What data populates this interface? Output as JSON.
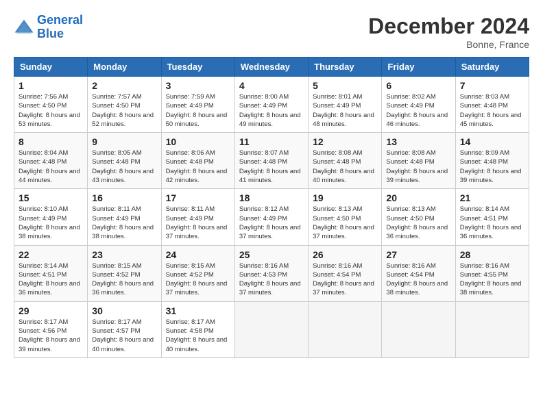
{
  "header": {
    "logo_line1": "General",
    "logo_line2": "Blue",
    "month": "December 2024",
    "location": "Bonne, France"
  },
  "weekdays": [
    "Sunday",
    "Monday",
    "Tuesday",
    "Wednesday",
    "Thursday",
    "Friday",
    "Saturday"
  ],
  "weeks": [
    [
      {
        "day": "1",
        "sunrise": "7:56 AM",
        "sunset": "4:50 PM",
        "daylight": "8 hours and 53 minutes."
      },
      {
        "day": "2",
        "sunrise": "7:57 AM",
        "sunset": "4:50 PM",
        "daylight": "8 hours and 52 minutes."
      },
      {
        "day": "3",
        "sunrise": "7:59 AM",
        "sunset": "4:49 PM",
        "daylight": "8 hours and 50 minutes."
      },
      {
        "day": "4",
        "sunrise": "8:00 AM",
        "sunset": "4:49 PM",
        "daylight": "8 hours and 49 minutes."
      },
      {
        "day": "5",
        "sunrise": "8:01 AM",
        "sunset": "4:49 PM",
        "daylight": "8 hours and 48 minutes."
      },
      {
        "day": "6",
        "sunrise": "8:02 AM",
        "sunset": "4:49 PM",
        "daylight": "8 hours and 46 minutes."
      },
      {
        "day": "7",
        "sunrise": "8:03 AM",
        "sunset": "4:48 PM",
        "daylight": "8 hours and 45 minutes."
      }
    ],
    [
      {
        "day": "8",
        "sunrise": "8:04 AM",
        "sunset": "4:48 PM",
        "daylight": "8 hours and 44 minutes."
      },
      {
        "day": "9",
        "sunrise": "8:05 AM",
        "sunset": "4:48 PM",
        "daylight": "8 hours and 43 minutes."
      },
      {
        "day": "10",
        "sunrise": "8:06 AM",
        "sunset": "4:48 PM",
        "daylight": "8 hours and 42 minutes."
      },
      {
        "day": "11",
        "sunrise": "8:07 AM",
        "sunset": "4:48 PM",
        "daylight": "8 hours and 41 minutes."
      },
      {
        "day": "12",
        "sunrise": "8:08 AM",
        "sunset": "4:48 PM",
        "daylight": "8 hours and 40 minutes."
      },
      {
        "day": "13",
        "sunrise": "8:08 AM",
        "sunset": "4:48 PM",
        "daylight": "8 hours and 39 minutes."
      },
      {
        "day": "14",
        "sunrise": "8:09 AM",
        "sunset": "4:48 PM",
        "daylight": "8 hours and 39 minutes."
      }
    ],
    [
      {
        "day": "15",
        "sunrise": "8:10 AM",
        "sunset": "4:49 PM",
        "daylight": "8 hours and 38 minutes."
      },
      {
        "day": "16",
        "sunrise": "8:11 AM",
        "sunset": "4:49 PM",
        "daylight": "8 hours and 38 minutes."
      },
      {
        "day": "17",
        "sunrise": "8:11 AM",
        "sunset": "4:49 PM",
        "daylight": "8 hours and 37 minutes."
      },
      {
        "day": "18",
        "sunrise": "8:12 AM",
        "sunset": "4:49 PM",
        "daylight": "8 hours and 37 minutes."
      },
      {
        "day": "19",
        "sunrise": "8:13 AM",
        "sunset": "4:50 PM",
        "daylight": "8 hours and 37 minutes."
      },
      {
        "day": "20",
        "sunrise": "8:13 AM",
        "sunset": "4:50 PM",
        "daylight": "8 hours and 36 minutes."
      },
      {
        "day": "21",
        "sunrise": "8:14 AM",
        "sunset": "4:51 PM",
        "daylight": "8 hours and 36 minutes."
      }
    ],
    [
      {
        "day": "22",
        "sunrise": "8:14 AM",
        "sunset": "4:51 PM",
        "daylight": "8 hours and 36 minutes."
      },
      {
        "day": "23",
        "sunrise": "8:15 AM",
        "sunset": "4:52 PM",
        "daylight": "8 hours and 36 minutes."
      },
      {
        "day": "24",
        "sunrise": "8:15 AM",
        "sunset": "4:52 PM",
        "daylight": "8 hours and 37 minutes."
      },
      {
        "day": "25",
        "sunrise": "8:16 AM",
        "sunset": "4:53 PM",
        "daylight": "8 hours and 37 minutes."
      },
      {
        "day": "26",
        "sunrise": "8:16 AM",
        "sunset": "4:54 PM",
        "daylight": "8 hours and 37 minutes."
      },
      {
        "day": "27",
        "sunrise": "8:16 AM",
        "sunset": "4:54 PM",
        "daylight": "8 hours and 38 minutes."
      },
      {
        "day": "28",
        "sunrise": "8:16 AM",
        "sunset": "4:55 PM",
        "daylight": "8 hours and 38 minutes."
      }
    ],
    [
      {
        "day": "29",
        "sunrise": "8:17 AM",
        "sunset": "4:56 PM",
        "daylight": "8 hours and 39 minutes."
      },
      {
        "day": "30",
        "sunrise": "8:17 AM",
        "sunset": "4:57 PM",
        "daylight": "8 hours and 40 minutes."
      },
      {
        "day": "31",
        "sunrise": "8:17 AM",
        "sunset": "4:58 PM",
        "daylight": "8 hours and 40 minutes."
      },
      null,
      null,
      null,
      null
    ]
  ],
  "labels": {
    "sunrise": "Sunrise:",
    "sunset": "Sunset:",
    "daylight": "Daylight:"
  }
}
